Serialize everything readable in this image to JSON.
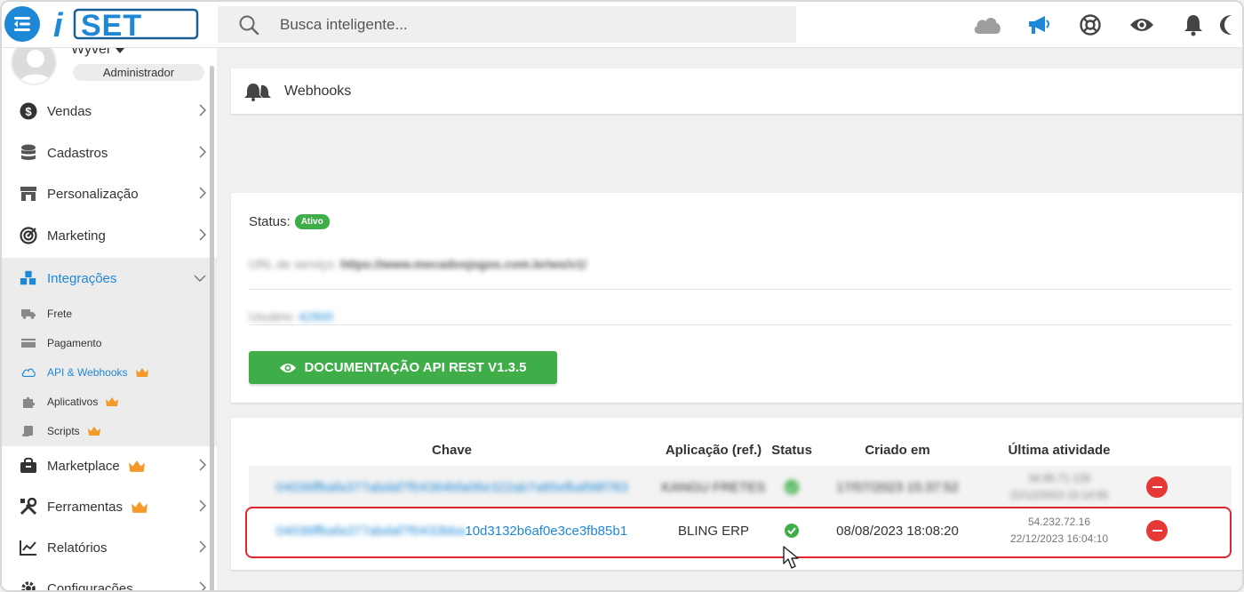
{
  "brand": {
    "logo_text": "iSET",
    "accent": "#1e88d6"
  },
  "search": {
    "placeholder": "Busca inteligente..."
  },
  "topbar_icons": [
    "cloud-icon",
    "megaphone-icon",
    "lifebuoy-icon",
    "eye-icon",
    "bell-icon",
    "moon-icon"
  ],
  "user": {
    "name": "Wyver",
    "role": "Administrador"
  },
  "sidebar": {
    "items": [
      {
        "label": "Vendas",
        "icon": "dollar-icon"
      },
      {
        "label": "Cadastros",
        "icon": "database-icon"
      },
      {
        "label": "Personalização",
        "icon": "store-icon"
      },
      {
        "label": "Marketing",
        "icon": "target-icon"
      },
      {
        "label": "Integrações",
        "icon": "cubes-icon",
        "active": true
      },
      {
        "label": "Marketplace",
        "icon": "basket-icon",
        "premium": true
      },
      {
        "label": "Ferramentas",
        "icon": "tools-icon",
        "premium": true
      },
      {
        "label": "Relatórios",
        "icon": "chart-icon"
      },
      {
        "label": "Configurações",
        "icon": "gear-icon"
      }
    ],
    "sub_items": [
      {
        "label": "Frete",
        "icon": "truck-icon"
      },
      {
        "label": "Pagamento",
        "icon": "card-icon"
      },
      {
        "label": "API & Webhooks",
        "icon": "cloud-icon",
        "active": true,
        "premium": true
      },
      {
        "label": "Aplicativos",
        "icon": "puzzle-icon",
        "premium": true
      },
      {
        "label": "Scripts",
        "icon": "scroll-icon",
        "premium": true
      }
    ]
  },
  "header": {
    "title": "Webhooks"
  },
  "status": {
    "label": "Status:",
    "badge": "Ativo",
    "url_label": "URL de serviço:",
    "url_value": "https://www.mecadosjogos.com.br/ws/v1/",
    "user_label": "Usuário:",
    "user_value": "42900"
  },
  "doc_button": {
    "label": "DOCUMENTAÇÃO API REST V1.3.5"
  },
  "table": {
    "headers": {
      "key": "Chave",
      "app": "Aplicação (ref.)",
      "status": "Status",
      "created": "Criado em",
      "last": "Última atividade"
    },
    "rows": [
      {
        "key": "04036ffbafa377abdaf7f04364bfa06e322ab7a85efbaf98f783",
        "app": "KANGU FRETES",
        "created": "17/07/2023 15:37:52",
        "ip": "34.95.71.126",
        "last": "22/12/2023 15:14:55"
      },
      {
        "key_hidden": "04036ffbafa377abdaf7f0433bba",
        "key_visible": "10d3132b6af0e3ce3fb85b1",
        "app": "BLING ERP",
        "created": "08/08/2023 18:08:20",
        "ip": "54.232.72.16",
        "last": "22/12/2023 16:04:10"
      }
    ]
  },
  "colors": {
    "green": "#3fae49",
    "red": "#e53935",
    "highlight": "#e0262b"
  }
}
